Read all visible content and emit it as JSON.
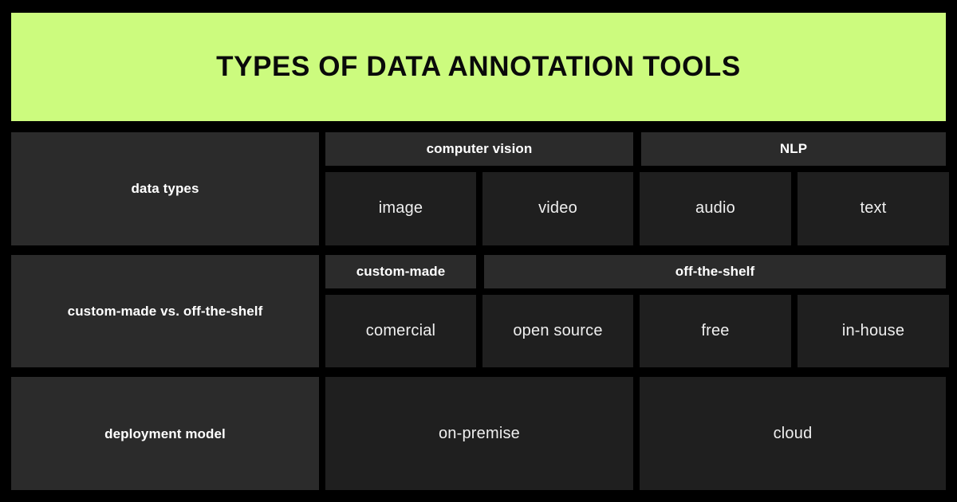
{
  "banner": {
    "title": "TYPES OF DATA ANNOTATION TOOLS",
    "background_color": "#ccfb7e",
    "text_color": "#0a0a0a"
  },
  "theme": {
    "page_background": "#000000",
    "label_cell_color": "#2b2b2b",
    "category_cell_color": "#2b2b2b",
    "value_cell_color": "#1f1f1f",
    "label_text_color": "#ffffff",
    "value_text_color": "#efefef"
  },
  "rows": [
    {
      "label": "data types",
      "categories": [
        {
          "label": "computer vision"
        },
        {
          "label": "NLP"
        }
      ],
      "values": [
        {
          "label": "image"
        },
        {
          "label": "video"
        },
        {
          "label": "audio"
        },
        {
          "label": "text"
        }
      ]
    },
    {
      "label": "custom-made vs. off-the-shelf",
      "categories": [
        {
          "label": "custom-made"
        },
        {
          "label": "off-the-shelf"
        }
      ],
      "values": [
        {
          "label": "comercial"
        },
        {
          "label": "open source"
        },
        {
          "label": "free"
        },
        {
          "label": "in-house"
        }
      ]
    },
    {
      "label": "deployment model",
      "categories": [],
      "values": [
        {
          "label": "on-premise"
        },
        {
          "label": "cloud"
        }
      ]
    }
  ]
}
